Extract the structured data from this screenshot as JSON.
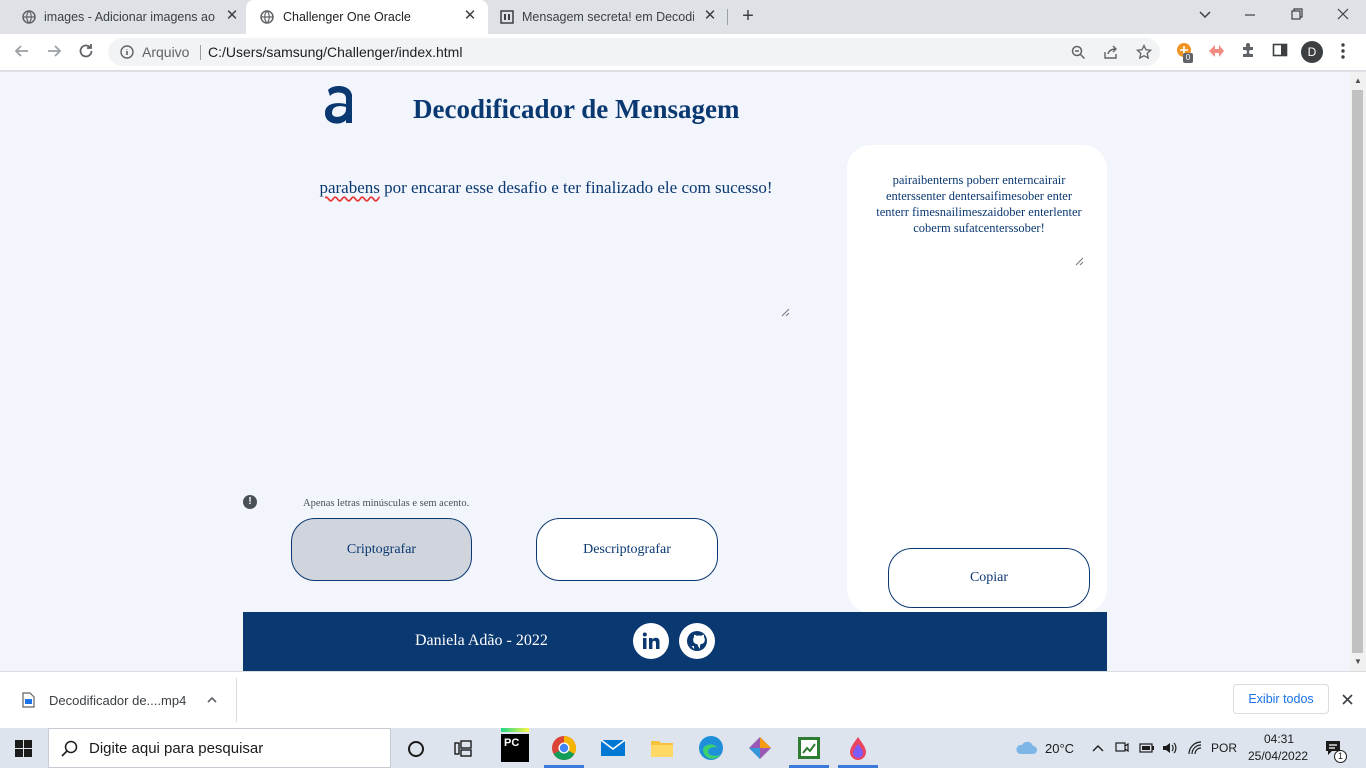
{
  "browser": {
    "tabs": [
      {
        "title": "images - Adicionar imagens ao R",
        "active": false
      },
      {
        "title": "Challenger One Oracle",
        "active": true
      },
      {
        "title": "Mensagem secreta! em Decodific",
        "active": false
      }
    ],
    "address": {
      "security_label": "Arquivo",
      "url": "C:/Users/samsung/Challenger/index.html"
    },
    "profile_initial": "D",
    "extension_badge": "0"
  },
  "page": {
    "heading": "Decodificador de Mensagem",
    "input": {
      "spell_word": "parabens",
      "rest": " por encarar esse desafio e ter finalizado ele com sucesso!"
    },
    "hint": "Apenas letras minúsculas e sem acento.",
    "buttons": {
      "encrypt": "Criptografar",
      "decrypt": "Descriptografar",
      "copy": "Copiar"
    },
    "output_text": "pairaibenterns poberr enterncairair enterssenter dentersaifimesober enter tenterr fimesnailimeszaidober enterlenter coberm sufatcenterssober!",
    "footer": {
      "text": "Daniela Adão - 2022"
    },
    "colors": {
      "primary": "#0a3871",
      "background": "#f3f5fc",
      "card": "#ffffff",
      "encrypt_button": "#d0d5dd"
    }
  },
  "downloads": {
    "file": "Decodificador de....mp4",
    "show_all": "Exibir todos"
  },
  "taskbar": {
    "search_placeholder": "Digite aqui para pesquisar",
    "weather": "20°C",
    "language": "POR",
    "time": "04:31",
    "date": "25/04/2022",
    "notification_count": "1"
  }
}
